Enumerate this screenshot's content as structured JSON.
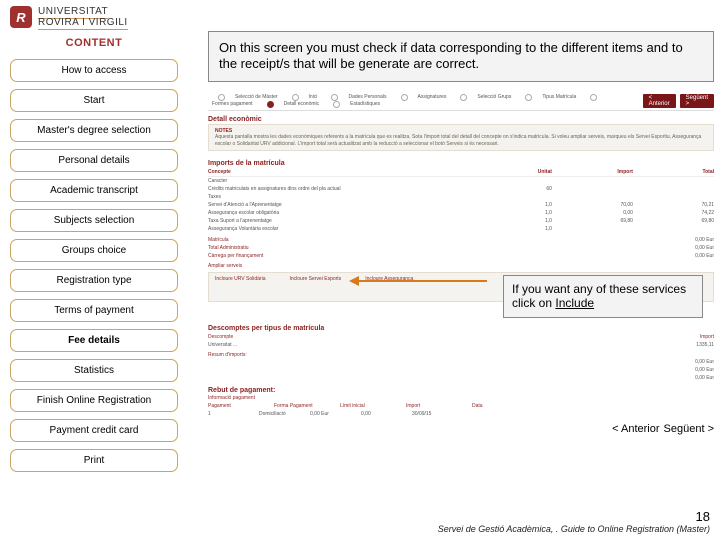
{
  "logo": {
    "badge": "R",
    "line1": "UNIVERSITAT",
    "line2": "ROVIRA I VIRGILI"
  },
  "content_heading": "CONTENT",
  "nav": [
    {
      "label": "How to access",
      "bold": false
    },
    {
      "label": "Start",
      "bold": false
    },
    {
      "label": "Master's degree selection",
      "bold": false
    },
    {
      "label": "Personal details",
      "bold": false
    },
    {
      "label": "Academic transcript",
      "bold": false
    },
    {
      "label": "Subjects selection",
      "bold": false
    },
    {
      "label": "Groups choice",
      "bold": false
    },
    {
      "label": "Registration type",
      "bold": false
    },
    {
      "label": "Terms of payment",
      "bold": false
    },
    {
      "label": "Fee details",
      "bold": true
    },
    {
      "label": "Statistics",
      "bold": false
    },
    {
      "label": "Finish Online Registration",
      "bold": false
    },
    {
      "label": "Payment credit card",
      "bold": false
    },
    {
      "label": "Print",
      "bold": false
    }
  ],
  "callout1": "On this screen you must check if data corresponding to the different items and to the receipt/s that will be generate are correct.",
  "wizard": {
    "steps": [
      "Selecció de Màster",
      "Inici",
      "Dades Personals",
      "Assignatures",
      "Selecció Grups",
      "Tipus Matrícula",
      "Formes pagament",
      "Detall econòmic",
      "Estadístiques"
    ],
    "prev": "< Anterior",
    "next": "Següent >"
  },
  "section_detail": "Detall econòmic",
  "notes": {
    "title": "NOTES",
    "body": "Aquesta pantalla mostra les dades econòmiques referents a la matrícula que es realitza. Sota l'import total del detall del concepte on s'indica matrícula. Si voleu ampliar serveis, marqueu els Servei Esportiu, Assegurança escolar o Solidaritat URV addicional. L'import total serà actualitzat amb la reducció a seleccionar el botó Serveis si és necessari."
  },
  "imports_title": "Imports de la matrícula",
  "concepts": {
    "header": {
      "a": "Concepte",
      "b": "Unitat",
      "c": "Import",
      "d": "Total"
    },
    "rows": [
      {
        "a": "Caracter",
        "b": "",
        "c": "",
        "d": ""
      },
      {
        "a": "Crèdits matriculats en assignatures dins ordre del pla actual",
        "b": "60",
        "c": "",
        "d": ""
      },
      {
        "a": "Taxes",
        "b": "",
        "c": "",
        "d": ""
      },
      {
        "a": "Servei d'Atenció a l'Aprenentatge",
        "b": "1,0",
        "c": "70,00",
        "d": "70,21"
      },
      {
        "a": "Assegurança escolar obligatòria",
        "b": "1,0",
        "c": "0,00",
        "d": "74,22"
      },
      {
        "a": "Taxa Suport a l'aprenentatge",
        "b": "1,0",
        "c": "69,80",
        "d": "69,80"
      },
      {
        "a": "Assegurança Voluntària escolar",
        "b": "1,0",
        "c": "",
        "d": ""
      }
    ]
  },
  "totals": [
    {
      "label": "Matrícula",
      "value": "0,00 Eur"
    },
    {
      "label": "Total Administratiu",
      "value": "0,00 Eur"
    },
    {
      "label": "Càrrega per finançament",
      "value": "0,00 Eur"
    }
  ],
  "services": {
    "title": "Ampliar serveis",
    "items": [
      "Incloure URV Solidària",
      "Incloure Servei Esports",
      "Incloure Assegurança"
    ]
  },
  "callout2": {
    "line1": "If you want any of these services",
    "line2_pre": "click on ",
    "line2_u": "Include"
  },
  "descompte_title": "Descomptes per tipus de matrícula",
  "descompte": {
    "head": [
      "Descompte",
      "Import"
    ],
    "row": [
      "Universitat ...",
      "1335,11"
    ]
  },
  "import_resum": "Resum d'imports:",
  "resum_rows": [
    {
      "label": "",
      "value": "0,00 Eur"
    },
    {
      "label": "",
      "value": "0,00 Eur"
    },
    {
      "label": "",
      "value": "0,00 Eur"
    }
  ],
  "rebut_title": "Rebut de pagament:",
  "rebut_intro": "Informació pagament",
  "rebut": {
    "headers": [
      "Pagament",
      "Forma Pagament",
      "Límit inicial",
      "Import",
      "Data"
    ],
    "values": [
      "1",
      "Domiciliació",
      "0,00 Eur",
      "0,00",
      "30/09/15"
    ]
  },
  "footer": {
    "page": "18",
    "source": "Servei de Gestió Acadèmica, . Guide to Online Registration (Master)"
  }
}
